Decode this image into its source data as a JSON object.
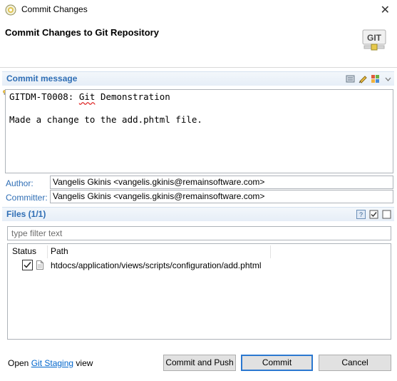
{
  "window": {
    "title": "Commit Changes"
  },
  "header": {
    "title": "Commit Changes to Git Repository",
    "logo_text": "GIT"
  },
  "commit_message": {
    "section_label": "Commit message",
    "line1_prefix": "GITDM-T0008: ",
    "line1_word": "Git",
    "line1_suffix": " Demonstration",
    "line3": "Made a change to the add.phtml file."
  },
  "author": {
    "label": "Author:",
    "value": "Vangelis Gkinis <vangelis.gkinis@remainsoftware.com>"
  },
  "committer": {
    "label": "Committer:",
    "value": "Vangelis Gkinis <vangelis.gkinis@remainsoftware.com>"
  },
  "files": {
    "section_label": "Files (1/1)",
    "filter_placeholder": "type filter text",
    "columns": [
      "Status",
      "Path"
    ],
    "rows": [
      {
        "checked": true,
        "path": "htdocs/application/views/scripts/configuration/add.phtml"
      }
    ]
  },
  "footer": {
    "open_text": "Open",
    "link_text": "Git Staging",
    "view_text": "view",
    "commit_and_push_label": "Commit and Push",
    "commit_label": "Commit",
    "cancel_label": "Cancel"
  },
  "colors": {
    "accent": "#2f6eb5",
    "link": "#0066cc",
    "default_button_border": "#2b78d0"
  }
}
